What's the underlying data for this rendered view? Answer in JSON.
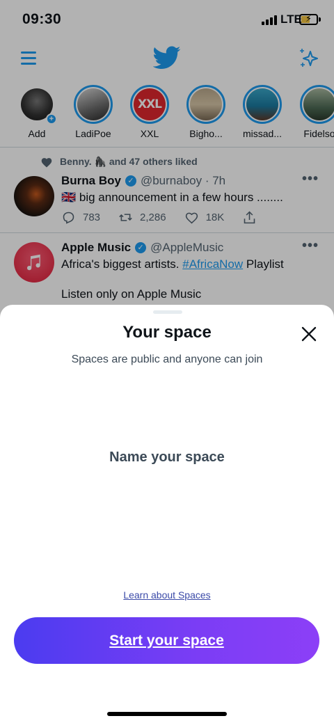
{
  "status_bar": {
    "time": "09:30",
    "network": "LTE"
  },
  "fleets": [
    {
      "label": "Add"
    },
    {
      "label": "LadiPoe"
    },
    {
      "label": "XXL"
    },
    {
      "label": "Bigho..."
    },
    {
      "label": "missad..."
    },
    {
      "label": "Fidelso"
    }
  ],
  "fleet_badge_text": "XXL",
  "tweets": [
    {
      "social_context": "Benny. 🦍 and 47 others liked",
      "name": "Burna Boy",
      "handle": "@burnaboy · 7h",
      "text": "🇬🇧 big announcement in a few hours ........",
      "replies": "783",
      "retweets": "2,286",
      "likes": "18K"
    },
    {
      "name": "Apple Music",
      "handle": "@AppleMusic",
      "text_before_link": "Africa's biggest artists. ",
      "hashtag": "#AfricaNow",
      "text_after_link": " Playlist",
      "text_line2": "Listen only on Apple Music"
    }
  ],
  "sheet": {
    "title": "Your space",
    "subtitle": "Spaces are public and anyone can join",
    "name_placeholder": "Name your space",
    "learn_link": "Learn about Spaces",
    "start_button": "Start your space"
  },
  "colors": {
    "accent": "#1d9bf0",
    "button_start": "#4b3cf0",
    "button_end": "#8c3ff7"
  }
}
